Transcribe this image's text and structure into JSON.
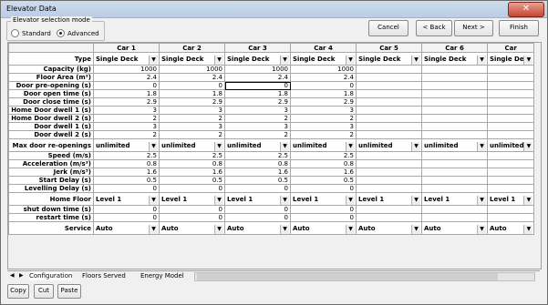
{
  "window": {
    "title": "Elevator Data",
    "close_glyph": "✕"
  },
  "mode": {
    "legend": "Elevator selection mode",
    "options": [
      {
        "label": "Standard",
        "selected": false
      },
      {
        "label": "Advanced",
        "selected": true
      }
    ]
  },
  "buttons": {
    "cancel": "Cancel",
    "back": "< Back",
    "next": "Next >",
    "finish": "Finish"
  },
  "grid": {
    "columns": [
      "Car 1",
      "Car 2",
      "Car 3",
      "Car 4",
      "Car 5",
      "Car 6",
      "Car"
    ],
    "rows": [
      {
        "label": "Type",
        "kind": "combo",
        "values": [
          "Single Deck",
          "Single Deck",
          "Single Deck",
          "Single Deck",
          "Single Deck",
          "Single Deck",
          "Single Deck"
        ]
      },
      {
        "label": "Capacity (kg)",
        "kind": "num",
        "values": [
          "1000",
          "1000",
          "1000",
          "1000",
          "",
          "",
          ""
        ]
      },
      {
        "label": "Floor Area (m²)",
        "kind": "num",
        "values": [
          "2.4",
          "2.4",
          "2.4",
          "2.4",
          "",
          "",
          ""
        ]
      },
      {
        "label": "Door pre-opening (s)",
        "kind": "num",
        "values": [
          "0",
          "0",
          "0",
          "0",
          "",
          "",
          ""
        ]
      },
      {
        "label": "Door open time (s)",
        "kind": "num",
        "values": [
          "1.8",
          "1.8",
          "1.8",
          "1.8",
          "",
          "",
          ""
        ]
      },
      {
        "label": "Door close time (s)",
        "kind": "num",
        "values": [
          "2.9",
          "2.9",
          "2.9",
          "2.9",
          "",
          "",
          ""
        ]
      },
      {
        "label": "Home Door dwell 1 (s)",
        "kind": "num",
        "values": [
          "3",
          "3",
          "3",
          "3",
          "",
          "",
          ""
        ]
      },
      {
        "label": "Home Door dwell 2 (s)",
        "kind": "num",
        "values": [
          "2",
          "2",
          "2",
          "2",
          "",
          "",
          ""
        ]
      },
      {
        "label": "Door dwell 1 (s)",
        "kind": "num",
        "values": [
          "3",
          "3",
          "3",
          "3",
          "",
          "",
          ""
        ]
      },
      {
        "label": "Door dwell 2 (s)",
        "kind": "num",
        "values": [
          "2",
          "2",
          "2",
          "2",
          "",
          "",
          ""
        ]
      },
      {
        "label": "Max door re-openings",
        "kind": "combo",
        "values": [
          "unlimited",
          "unlimited",
          "unlimited",
          "unlimited",
          "unlimited",
          "unlimited",
          "unlimited"
        ]
      },
      {
        "label": "Speed (m/s)",
        "kind": "num",
        "values": [
          "2.5",
          "2.5",
          "2.5",
          "2.5",
          "",
          "",
          ""
        ]
      },
      {
        "label": "Acceleration (m/s²)",
        "kind": "num",
        "values": [
          "0.8",
          "0.8",
          "0.8",
          "0.8",
          "",
          "",
          ""
        ]
      },
      {
        "label": "Jerk (m/s³)",
        "kind": "num",
        "values": [
          "1.6",
          "1.6",
          "1.6",
          "1.6",
          "",
          "",
          ""
        ]
      },
      {
        "label": "Start Delay (s)",
        "kind": "num",
        "values": [
          "0.5",
          "0.5",
          "0.5",
          "0.5",
          "",
          "",
          ""
        ]
      },
      {
        "label": "Levelling Delay (s)",
        "kind": "num",
        "values": [
          "0",
          "0",
          "0",
          "0",
          "",
          "",
          ""
        ]
      },
      {
        "label": "Home Floor",
        "kind": "combo",
        "values": [
          "Level 1",
          "Level 1",
          "Level 1",
          "Level 1",
          "Level 1",
          "Level 1",
          "Level 1"
        ]
      },
      {
        "label": "shut down time (s)",
        "kind": "num",
        "values": [
          "0",
          "0",
          "0",
          "0",
          "",
          "",
          ""
        ]
      },
      {
        "label": "restart time (s)",
        "kind": "num",
        "values": [
          "0",
          "0",
          "0",
          "0",
          "",
          "",
          ""
        ]
      },
      {
        "label": "Service",
        "kind": "combo",
        "values": [
          "Auto",
          "Auto",
          "Auto",
          "Auto",
          "Auto",
          "Auto",
          "Auto"
        ]
      }
    ],
    "selected_cell": {
      "row": 3,
      "col": 2
    }
  },
  "tabs": [
    {
      "label": "Configuration",
      "active": true
    },
    {
      "label": "Floors Served",
      "active": false
    },
    {
      "label": "Energy Model",
      "active": false
    }
  ],
  "bottom_buttons": {
    "copy": "Copy",
    "cut": "Cut",
    "paste": "Paste"
  },
  "colors": {
    "title_bar": "#c3d4ea",
    "close_button": "#c7442f"
  }
}
